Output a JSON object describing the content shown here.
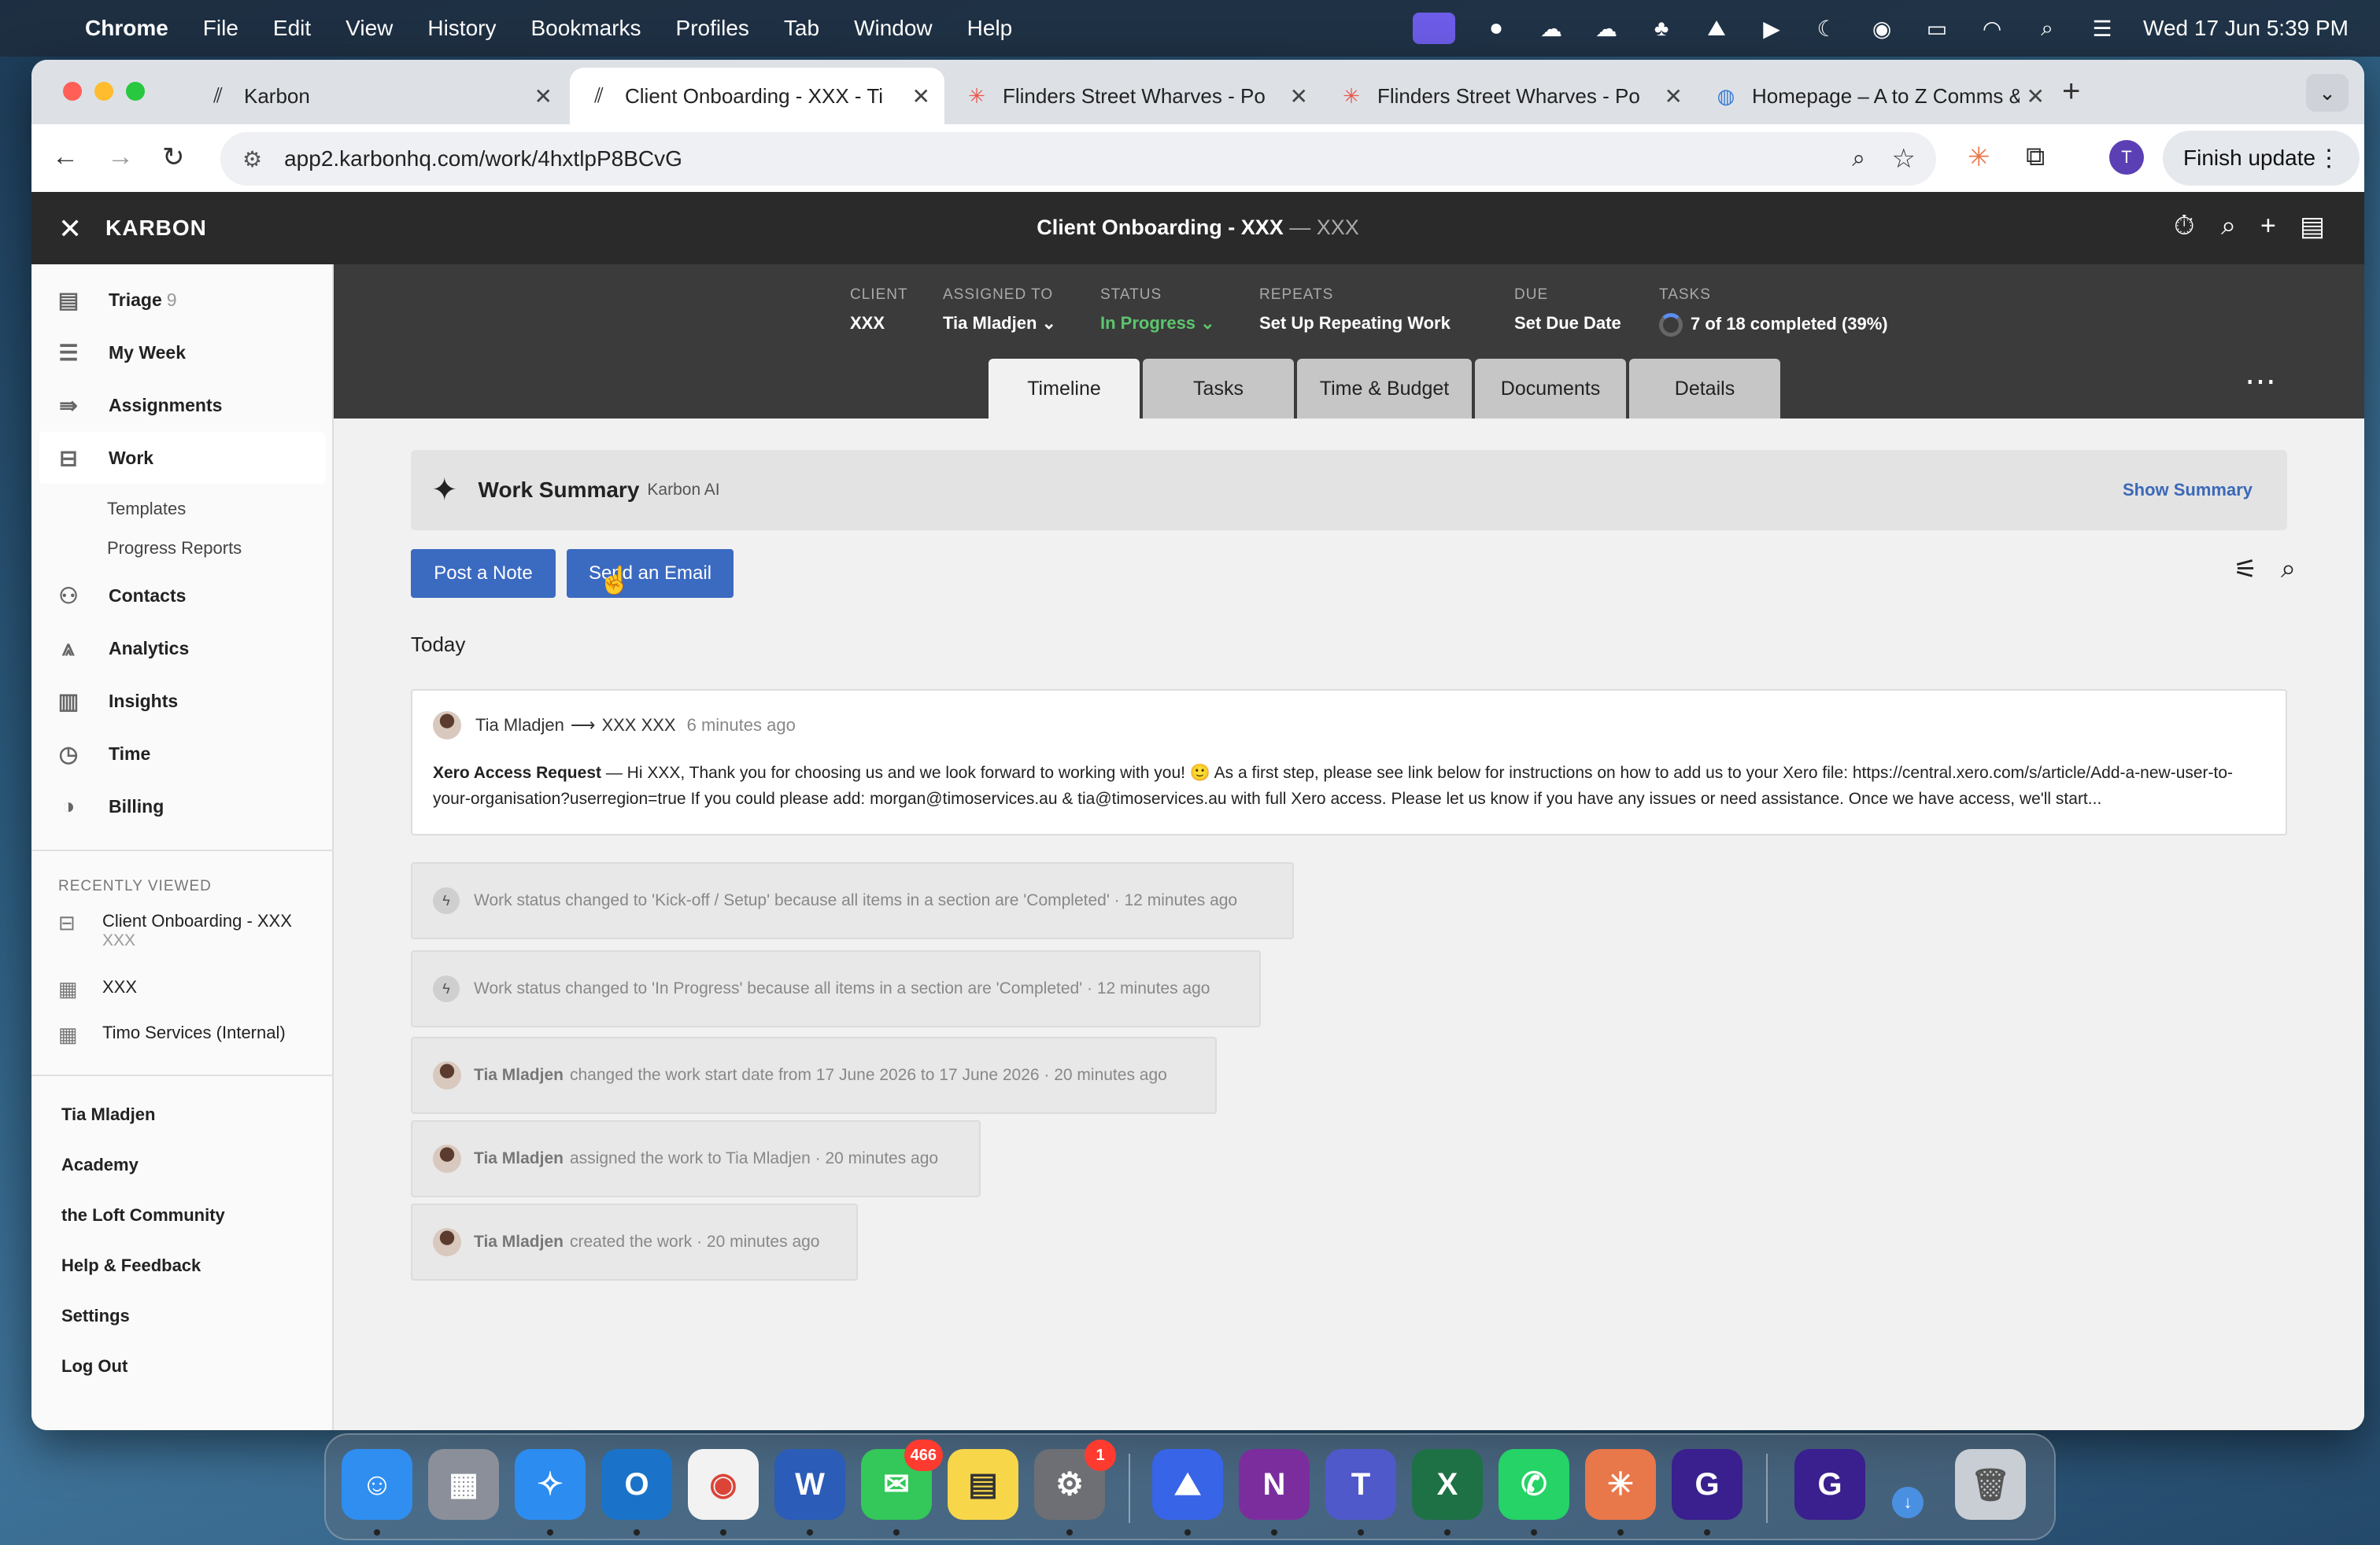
{
  "menubar": {
    "app_name": "Chrome",
    "menus": [
      "File",
      "Edit",
      "View",
      "History",
      "Bookmarks",
      "Profiles",
      "Tab",
      "Window",
      "Help"
    ],
    "clock": "Wed 17 Jun  5:39 PM"
  },
  "browser": {
    "tabs": [
      {
        "title": "Karbon",
        "icon": "karbon-icon"
      },
      {
        "title": "Client Onboarding - XXX - Ti",
        "icon": "karbon-icon"
      },
      {
        "title": "Flinders Street Wharves - Po",
        "icon": "asterisk-icon"
      },
      {
        "title": "Flinders Street Wharves - Po",
        "icon": "asterisk-icon"
      },
      {
        "title": "Homepage – A to Z Comms &",
        "icon": "globe-icon"
      }
    ],
    "url": "app2.karbonhq.com/work/4hxtlpP8BCvG",
    "profile_initial": "T",
    "finish_update_label": "Finish update"
  },
  "app": {
    "brand": "KARBON",
    "page_title": "Client Onboarding - XXX",
    "page_title_sep": " — ",
    "page_subtitle": "XXX"
  },
  "sidebar": {
    "items": [
      {
        "label": "Triage",
        "count": "9",
        "icon": "triage-icon"
      },
      {
        "label": "My Week",
        "icon": "list-icon"
      },
      {
        "label": "Assignments",
        "icon": "assign-icon"
      },
      {
        "label": "Work",
        "icon": "briefcase-icon"
      },
      {
        "label": "Contacts",
        "icon": "contacts-icon"
      },
      {
        "label": "Analytics",
        "icon": "analytics-icon"
      },
      {
        "label": "Insights",
        "icon": "bars-icon"
      },
      {
        "label": "Time",
        "icon": "clock-icon"
      },
      {
        "label": "Billing",
        "icon": "billing-icon"
      }
    ],
    "work_sub": [
      "Templates",
      "Progress Reports"
    ],
    "recently_viewed_label": "RECENTLY VIEWED",
    "recent": [
      {
        "title": "Client Onboarding - XXX",
        "sub": "XXX"
      },
      {
        "title": "XXX",
        "sub": ""
      },
      {
        "title": "Timo Services (Internal)",
        "sub": ""
      }
    ],
    "links": [
      "Tia Mladjen",
      "Academy",
      "the Loft Community",
      "Help & Feedback",
      "Settings",
      "Log Out"
    ]
  },
  "work": {
    "meta": [
      {
        "key": "CLIENT",
        "value": "XXX"
      },
      {
        "key": "ASSIGNED TO",
        "value": "Tia Mladjen ⌄"
      },
      {
        "key": "STATUS",
        "value": "In Progress ⌄"
      },
      {
        "key": "REPEATS",
        "value": "Set Up Repeating Work"
      },
      {
        "key": "DUE",
        "value": "Set Due Date"
      },
      {
        "key": "TASKS",
        "value": "7 of 18 completed (39%)"
      }
    ],
    "tasks_progress": 0.39,
    "tabs": [
      "Timeline",
      "Tasks",
      "Time & Budget",
      "Documents",
      "Details"
    ]
  },
  "timeline": {
    "summary_title": "Work Summary",
    "summary_sub": "Karbon AI",
    "show_summary": "Show Summary",
    "post_note": "Post a Note",
    "send_email": "Send an Email",
    "today": "Today",
    "note": {
      "author": "Tia Mladjen",
      "arrow": "⟶",
      "recipient": "XXX XXX",
      "time": "6 minutes ago",
      "subject": "Xero Access Request",
      "body": " — Hi XXX, Thank you for choosing us and we look forward to working with you! 🙂 As a first step, please see link below for instructions on how to add us to your Xero file: https://central.xero.com/s/article/Add-a-new-user-to-your-organisation?userregion=true If you could please add: morgan@timoservices.au & tia@timoservices.au with full Xero access. Please let us know if you have any issues or need assistance. Once we have access, we'll start..."
    },
    "activities": [
      {
        "type": "system",
        "name": "",
        "text": "Work status changed to 'Kick-off / Setup' because all items in a section are 'Completed' ·  12 minutes ago"
      },
      {
        "type": "system",
        "name": "",
        "text": "Work status changed to 'In Progress' because all items in a section are 'Completed' ·  12 minutes ago"
      },
      {
        "type": "user",
        "name": "Tia Mladjen",
        "text": "changed the work start date from 17 June 2026 to 17 June 2026 ·  20 minutes ago"
      },
      {
        "type": "user",
        "name": "Tia Mladjen",
        "text": "assigned the work to Tia Mladjen ·  20 minutes ago"
      },
      {
        "type": "user",
        "name": "Tia Mladjen",
        "text": "created the work ·  20 minutes ago"
      }
    ]
  },
  "dock": {
    "messages_badge": "466",
    "settings_badge": "1"
  },
  "colors": {
    "accent": "#3b6ac1",
    "status_green": "#5cc66d",
    "header_dark": "#2a2a2a"
  }
}
